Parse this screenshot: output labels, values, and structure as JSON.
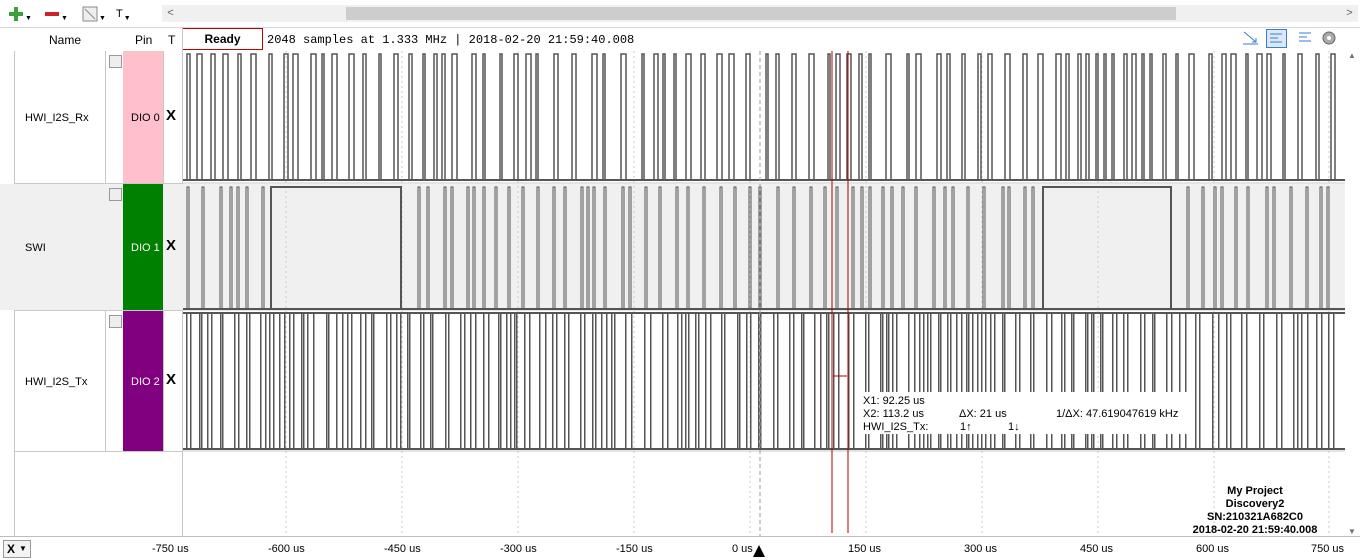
{
  "toolbar": {
    "add_icon": "plus-icon",
    "remove_icon": "minus-icon",
    "edit_icon": "edit-icon",
    "text_label": "T"
  },
  "header": {
    "name_col": "Name",
    "pin_col": "Pin",
    "t_col": "T",
    "status": "Ready",
    "info": "2048 samples at 1.333 MHz | 2018-02-20 21:59:40.008"
  },
  "channels": [
    {
      "name": "HWI_I2S_Rx",
      "pin": "DIO 0",
      "color": "#ffc0cb",
      "trigger": "X"
    },
    {
      "name": "SWI",
      "pin": "DIO 1",
      "color": "#008000",
      "trigger": "X"
    },
    {
      "name": "HWI_I2S_Tx",
      "pin": "DIO 2",
      "color": "#800080",
      "trigger": "X"
    }
  ],
  "axis": {
    "ticks": [
      "-750 us",
      "-600 us",
      "-450 us",
      "-300 us",
      "-150 us",
      "0 us",
      "150 us",
      "300 us",
      "450 us",
      "600 us",
      "750 us"
    ],
    "x_button": "X"
  },
  "cursor_info": {
    "x1": "X1: 92.25 us",
    "x2": "X2: 113.2 us",
    "dx": "ΔX: 21 us",
    "inv": "1/ΔX: 47.619047619 kHz",
    "ch": "HWI_I2S_Tx:",
    "rise": "1↑",
    "fall": "1↓"
  },
  "device": {
    "line1": "My Project",
    "line2": "Discovery2",
    "line3": "SN:210321A682C0",
    "line4": "2018-02-20 21:59:40.008"
  },
  "colors": {
    "cursor": "#b00000",
    "trace": "#555555"
  }
}
